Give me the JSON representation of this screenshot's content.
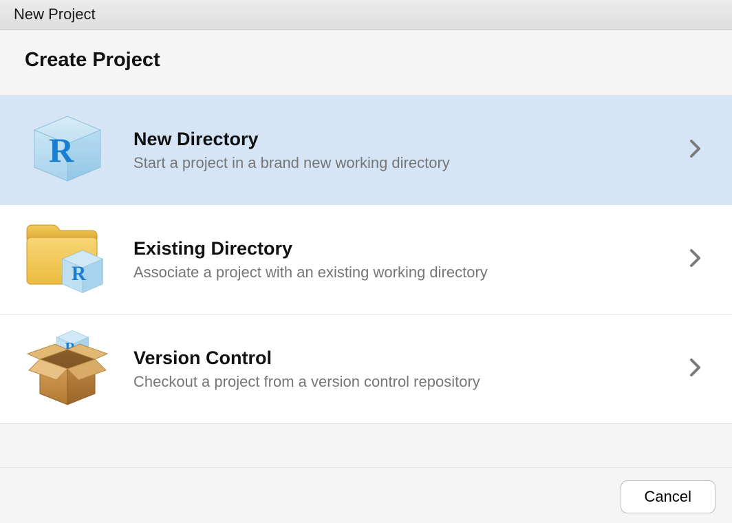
{
  "titlebar": {
    "title": "New Project"
  },
  "header": {
    "title": "Create Project"
  },
  "options": [
    {
      "title": "New Directory",
      "subtitle": "Start a project in a brand new working directory",
      "selected": true
    },
    {
      "title": "Existing Directory",
      "subtitle": "Associate a project with an existing working directory",
      "selected": false
    },
    {
      "title": "Version Control",
      "subtitle": "Checkout a project from a version control repository",
      "selected": false
    }
  ],
  "footer": {
    "cancel_label": "Cancel"
  }
}
